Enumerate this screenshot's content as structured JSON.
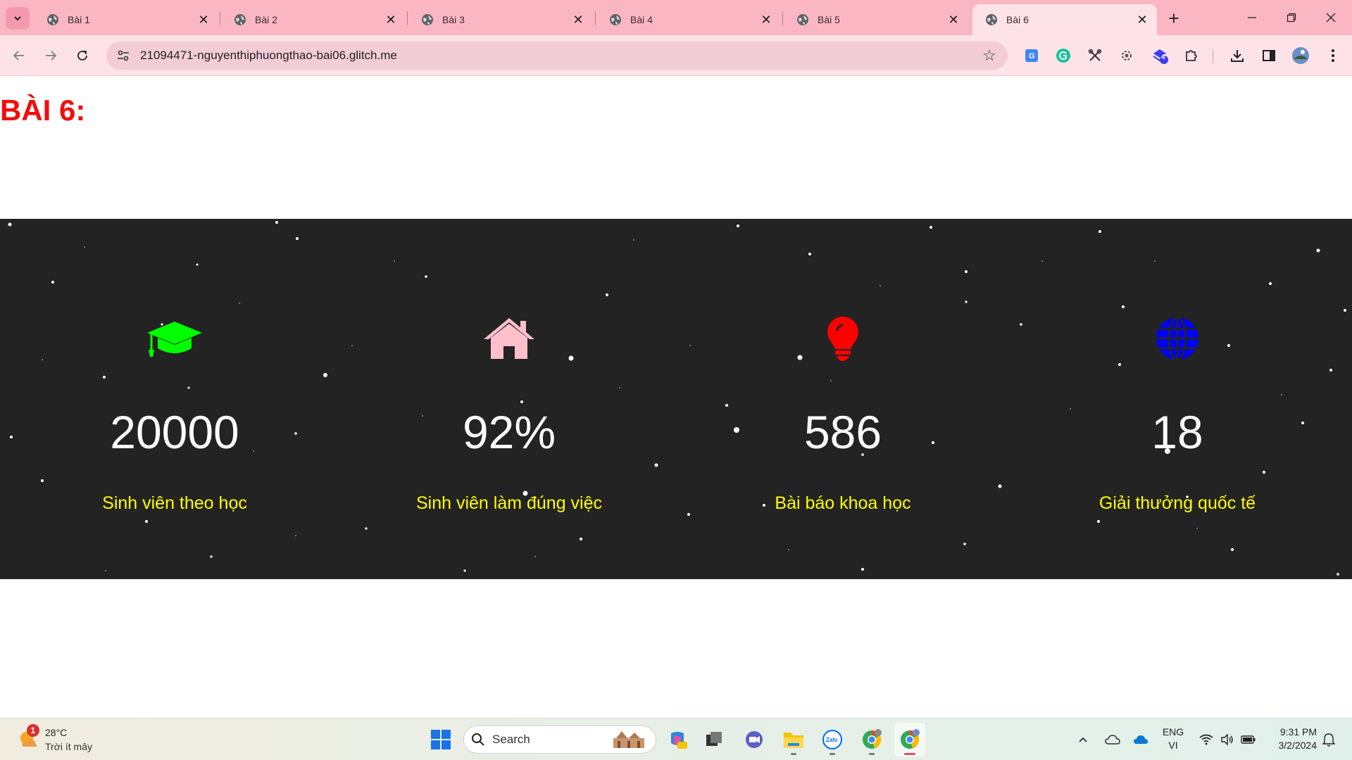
{
  "browser": {
    "tabs": [
      {
        "title": "Bài 1",
        "active": false
      },
      {
        "title": "Bài 2",
        "active": false
      },
      {
        "title": "Bài 3",
        "active": false
      },
      {
        "title": "Bài 4",
        "active": false
      },
      {
        "title": "Bài 5",
        "active": false
      },
      {
        "title": "Bài 6",
        "active": true
      }
    ],
    "url": "21094471-nguyenthiphuongthao-bai06.glitch.me",
    "extension_badge": "4"
  },
  "page": {
    "heading": "BÀI 6:",
    "stats": [
      {
        "icon": "graduation-cap-icon",
        "icon_color": "#00ff00",
        "value": "20000",
        "label": "Sinh viên theo học"
      },
      {
        "icon": "home-icon",
        "icon_color": "#ffc0cb",
        "value": "92%",
        "label": "Sinh viên làm đúng việc"
      },
      {
        "icon": "lightbulb-icon",
        "icon_color": "#ff0000",
        "value": "586",
        "label": "Bài báo khoa học"
      },
      {
        "icon": "globe-icon",
        "icon_color": "#0000ff",
        "value": "18",
        "label": "Giải thưởng quốc tế"
      }
    ],
    "colors": {
      "heading": "#f20d0d",
      "band": "#232323",
      "value": "#ffffff",
      "label": "#ffff00"
    }
  },
  "taskbar": {
    "weather": {
      "temp": "28°C",
      "desc": "Trời ít mây",
      "badge": "1"
    },
    "search_placeholder": "Search",
    "language": {
      "line1": "ENG",
      "line2": "VI"
    },
    "clock": {
      "time": "9:31 PM",
      "date": "3/2/2024"
    }
  }
}
